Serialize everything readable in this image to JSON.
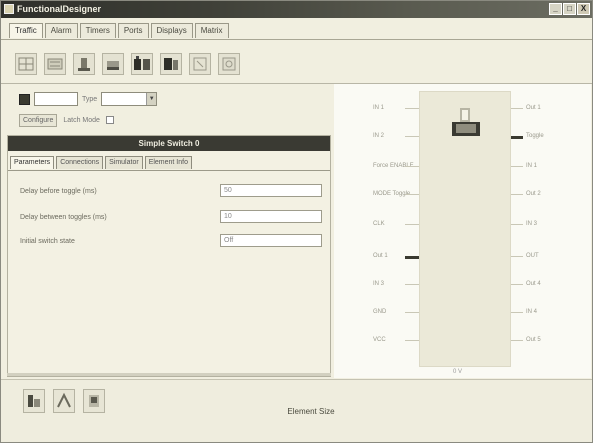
{
  "window": {
    "title": "FunctionalDesigner",
    "buttons": [
      "_",
      "□",
      "X"
    ]
  },
  "tabs": [
    "Traffic",
    "Alarm",
    "Timers",
    "Ports",
    "Displays",
    "Matrix"
  ],
  "toolbar": {
    "icons": [
      "grid-icon",
      "panel-icon",
      "switch-icon",
      "switch2-icon",
      "relay-icon",
      "relay2-icon",
      "meter-icon",
      "dial-icon"
    ]
  },
  "selectors": {
    "field1_value": "",
    "type_label": "Type",
    "type_value": "",
    "button_label": "Configure",
    "check_label": "Latch Mode"
  },
  "panel": {
    "title": "Simple Switch 0",
    "tabs": [
      "Parameters",
      "Connections",
      "Simulator",
      "Element Info"
    ],
    "params": [
      {
        "label": "Delay before toggle (ms)",
        "value": "50"
      },
      {
        "label": "Delay between toggles (ms)",
        "value": "10"
      },
      {
        "label": "Initial switch state",
        "value": "Off"
      }
    ]
  },
  "schematic": {
    "left_pins": [
      "IN 1",
      "IN 2",
      "Force ENABLE",
      "MODE Toggle",
      "CLK",
      "Out 1",
      "IN 3",
      "GND",
      "VCC"
    ],
    "right_pins": [
      "Out 1",
      "Toggle",
      "IN 1",
      "Out 2",
      "IN 3",
      "OUT",
      "Out 4",
      "IN 4",
      "Out 5"
    ],
    "bottom_label": "0 V"
  },
  "footer": {
    "tool_icons": [
      "add-element-icon",
      "wire-icon",
      "probe-icon"
    ],
    "element_label": "Element Size"
  }
}
